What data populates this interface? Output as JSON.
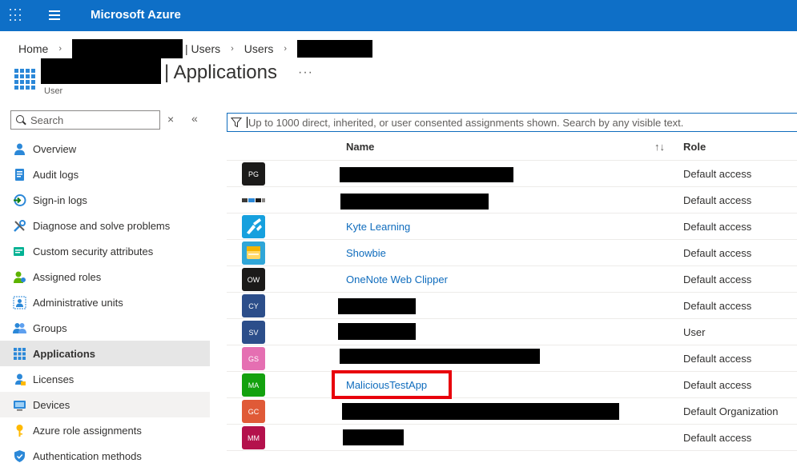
{
  "header": {
    "brand": "Microsoft Azure",
    "bar_color": "#0e6fc7"
  },
  "breadcrumb": {
    "home": "Home",
    "users_suffix": "| Users",
    "users": "Users"
  },
  "page": {
    "title_suffix": "| Applications",
    "more": "···",
    "subtitle": "User"
  },
  "sidebar": {
    "search_placeholder": "Search",
    "clear": "×",
    "collapse": "«",
    "items": [
      {
        "label": "Overview",
        "icon": "person-icon"
      },
      {
        "label": "Audit logs",
        "icon": "audit-log-icon"
      },
      {
        "label": "Sign-in logs",
        "icon": "sign-in-icon"
      },
      {
        "label": "Diagnose and solve problems",
        "icon": "wrench-icon"
      },
      {
        "label": "Custom security attributes",
        "icon": "attributes-icon"
      },
      {
        "label": "Assigned roles",
        "icon": "roles-icon"
      },
      {
        "label": "Administrative units",
        "icon": "admin-units-icon"
      },
      {
        "label": "Groups",
        "icon": "groups-icon"
      },
      {
        "label": "Applications",
        "icon": "apps-grid-icon"
      },
      {
        "label": "Licenses",
        "icon": "license-icon"
      },
      {
        "label": "Devices",
        "icon": "device-icon"
      },
      {
        "label": "Azure role assignments",
        "icon": "key-icon"
      },
      {
        "label": "Authentication methods",
        "icon": "shield-icon"
      }
    ]
  },
  "filter": {
    "placeholder": "Up to 1000 direct, inherited, or user consented assignments shown. Search by any visible text."
  },
  "table": {
    "columns": {
      "name": "Name",
      "sort": "↑↓",
      "role": "Role"
    },
    "rows": [
      {
        "initials": "PG",
        "color": "#1b1a19",
        "name": "",
        "role": "Default access"
      },
      {
        "initials": "",
        "color": "#ffffff",
        "name": "",
        "role": "Default access"
      },
      {
        "initials": "",
        "color": "#1aa3e0",
        "name": "Kyte Learning",
        "role": "Default access"
      },
      {
        "initials": "",
        "color": "#2fa6d8",
        "name": "Showbie",
        "role": "Default access"
      },
      {
        "initials": "OW",
        "color": "#1b1a19",
        "name": "OneNote Web Clipper",
        "role": "Default access"
      },
      {
        "initials": "CY",
        "color": "#2c4e8a",
        "name": "",
        "role": "Default access"
      },
      {
        "initials": "SV",
        "color": "#2c4e8a",
        "name": "",
        "role": "User"
      },
      {
        "initials": "GS",
        "color": "#e56fb2",
        "name": "",
        "role": "Default access"
      },
      {
        "initials": "MA",
        "color": "#13a10e",
        "name": "MaliciousTestApp",
        "role": "Default access"
      },
      {
        "initials": "GC",
        "color": "#e05a37",
        "name": "",
        "role": "Default Organization"
      },
      {
        "initials": "MM",
        "color": "#b4114c",
        "name": "",
        "role": "Default access"
      }
    ]
  }
}
